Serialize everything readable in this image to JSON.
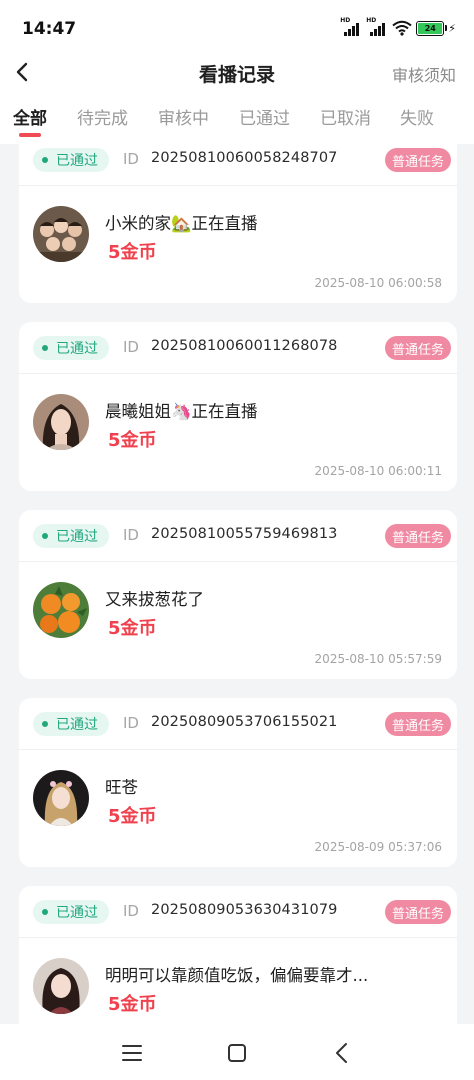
{
  "status_bar": {
    "time": "14:47",
    "signal_label": "HD",
    "battery": "24"
  },
  "header": {
    "title": "看播记录",
    "right_link": "审核须知"
  },
  "tabs": [
    {
      "label": "全部",
      "active": true
    },
    {
      "label": "待完成",
      "active": false
    },
    {
      "label": "审核中",
      "active": false
    },
    {
      "label": "已通过",
      "active": false
    },
    {
      "label": "已取消",
      "active": false
    },
    {
      "label": "失败",
      "active": false
    }
  ],
  "records": [
    {
      "status": "已通过",
      "id_label": "ID",
      "id": "20250810060058248707",
      "type": "普通任务",
      "streamer": "小米的家🏡正在直播",
      "reward": "5金币",
      "time": "2025-08-10 06:00:58"
    },
    {
      "status": "已通过",
      "id_label": "ID",
      "id": "20250810060011268078",
      "type": "普通任务",
      "streamer": "晨曦姐姐🦄正在直播",
      "reward": "5金币",
      "time": "2025-08-10 06:00:11"
    },
    {
      "status": "已通过",
      "id_label": "ID",
      "id": "20250810055759469813",
      "type": "普通任务",
      "streamer": "又来拔葱花了",
      "reward": "5金币",
      "time": "2025-08-10 05:57:59"
    },
    {
      "status": "已通过",
      "id_label": "ID",
      "id": "20250809053706155021",
      "type": "普通任务",
      "streamer": "旺苍",
      "reward": "5金币",
      "time": "2025-08-09 05:37:06"
    },
    {
      "status": "已通过",
      "id_label": "ID",
      "id": "20250809053630431079",
      "type": "普通任务",
      "streamer": "明明可以靠颜值吃饭，偏偏要靠才...",
      "reward": "5金币",
      "time": ""
    }
  ],
  "colors": {
    "accent": "#f04a55",
    "status_green": "#22a77d",
    "tag_pink": "#f08aa2"
  }
}
